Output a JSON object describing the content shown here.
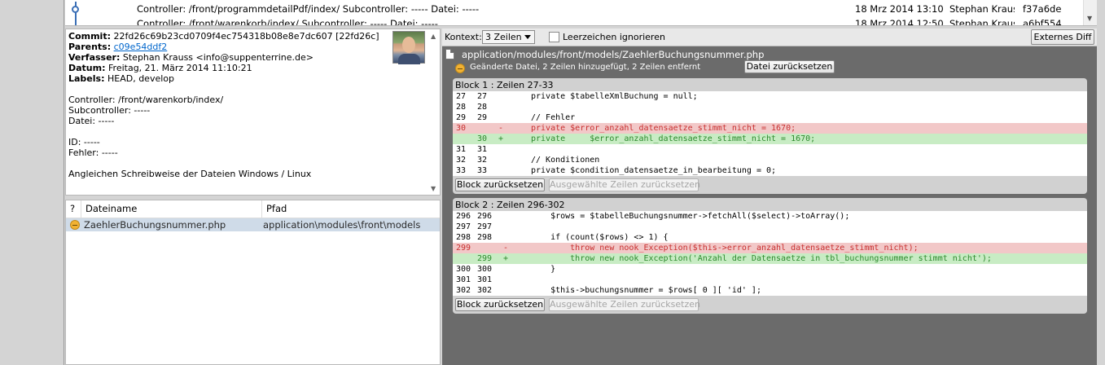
{
  "log": {
    "rows": [
      {
        "message": "Controller: /front/programmdetailPdf/index/ Subcontroller: ----- Datei: -----",
        "date": "18 Mrz 2014 13:10",
        "author": "Stephan Krauss <ir",
        "sha": "f37a6de"
      },
      {
        "message": "Controller: /front/warenkorb/index/ Subcontroller: ----- Datei: -----",
        "date": "18 Mrz 2014 12:50",
        "author": "Stephan Krauss <ir",
        "sha": "a6bf554"
      }
    ]
  },
  "commit": {
    "commit_label": "Commit:",
    "commit_value": "22fd26c69b23cd0709f4ec754318b08e8e7dc607 [22fd26c]",
    "parents_label": "Parents:",
    "parents_value": "c09e54ddf2",
    "author_label": "Verfasser:",
    "author_value": "Stephan Krauss <info@suppenterrine.de>",
    "date_label": "Datum:",
    "date_value": "Freitag, 21. März 2014 11:10:21",
    "labels_label": "Labels:",
    "labels_value": "HEAD, develop",
    "message_lines": [
      "Controller: /front/warenkorb/index/",
      "Subcontroller: -----",
      "Datei: -----",
      "",
      "ID: -----",
      "Fehler: -----",
      "",
      "Angleichen Schreibweise der Dateien Windows / Linux"
    ]
  },
  "files": {
    "headers": {
      "status": "?",
      "name": "Dateiname",
      "path": "Pfad"
    },
    "rows": [
      {
        "name": "ZaehlerBuchungsnummer.php",
        "path": "application\\modules\\front\\models"
      }
    ]
  },
  "diff": {
    "context_label": "Kontext:",
    "context_value": "3 Zeilen",
    "ignore_whitespace_label": "Leerzeichen ignorieren",
    "external_diff_label": "Externes Diff",
    "file_path": "application/modules/front/models/ZaehlerBuchungsnummer.php",
    "file_status": "Geänderte Datei, 2 Zeilen hinzugefügt, 2 Zeilen entfernt",
    "reset_file_label": "Datei zurücksetzen",
    "hunks": [
      {
        "title": "Block 1 : Zeilen  27-33",
        "reset_label": "Block zurücksetzen",
        "reset_selected_label": "Ausgewählte Zeilen zurücksetzen",
        "lines": [
          {
            "type": "ctx",
            "old": "27",
            "new": "27",
            "mark": "",
            "code": "private $tabelleXmlBuchung = null;"
          },
          {
            "type": "ctx",
            "old": "28",
            "new": "28",
            "mark": "",
            "code": ""
          },
          {
            "type": "ctx",
            "old": "29",
            "new": "29",
            "mark": "",
            "code": "// Fehler"
          },
          {
            "type": "del",
            "old": "30",
            "new": "",
            "mark": "-",
            "code": "private $error_anzahl_datensaetze_stimmt_nicht = 1670;"
          },
          {
            "type": "add",
            "old": "",
            "new": "30",
            "mark": "+",
            "code": "private     $error_anzahl_datensaetze_stimmt_nicht = 1670;"
          },
          {
            "type": "ctx",
            "old": "31",
            "new": "31",
            "mark": "",
            "code": ""
          },
          {
            "type": "ctx",
            "old": "32",
            "new": "32",
            "mark": "",
            "code": "// Konditionen"
          },
          {
            "type": "ctx",
            "old": "33",
            "new": "33",
            "mark": "",
            "code": "private $condition_datensaetze_in_bearbeitung = 0;"
          }
        ]
      },
      {
        "title": "Block 2 : Zeilen  296-302",
        "reset_label": "Block zurücksetzen",
        "reset_selected_label": "Ausgewählte Zeilen zurücksetzen",
        "lines": [
          {
            "type": "ctx",
            "old": "296",
            "new": "296",
            "mark": "",
            "code": "    $rows = $tabelleBuchungsnummer->fetchAll($select)->toArray();"
          },
          {
            "type": "ctx",
            "old": "297",
            "new": "297",
            "mark": "",
            "code": ""
          },
          {
            "type": "ctx",
            "old": "298",
            "new": "298",
            "mark": "",
            "code": "    if (count($rows) <> 1) {"
          },
          {
            "type": "del",
            "old": "299",
            "new": "",
            "mark": " -",
            "code": "        throw new nook_Exception($this->error_anzahl_datensaetze_stimmt_nicht);"
          },
          {
            "type": "add",
            "old": "",
            "new": "299",
            "mark": " +",
            "code": "        throw new nook_Exception('Anzahl der Datensaetze in tbl_buchungsnummer stimmt nicht');"
          },
          {
            "type": "ctx",
            "old": "300",
            "new": "300",
            "mark": "",
            "code": "    }"
          },
          {
            "type": "ctx",
            "old": "301",
            "new": "301",
            "mark": "",
            "code": ""
          },
          {
            "type": "ctx",
            "old": "302",
            "new": "302",
            "mark": "",
            "code": "    $this->buchungsnummer = $rows[ 0 ][ 'id' ];"
          }
        ]
      }
    ]
  }
}
